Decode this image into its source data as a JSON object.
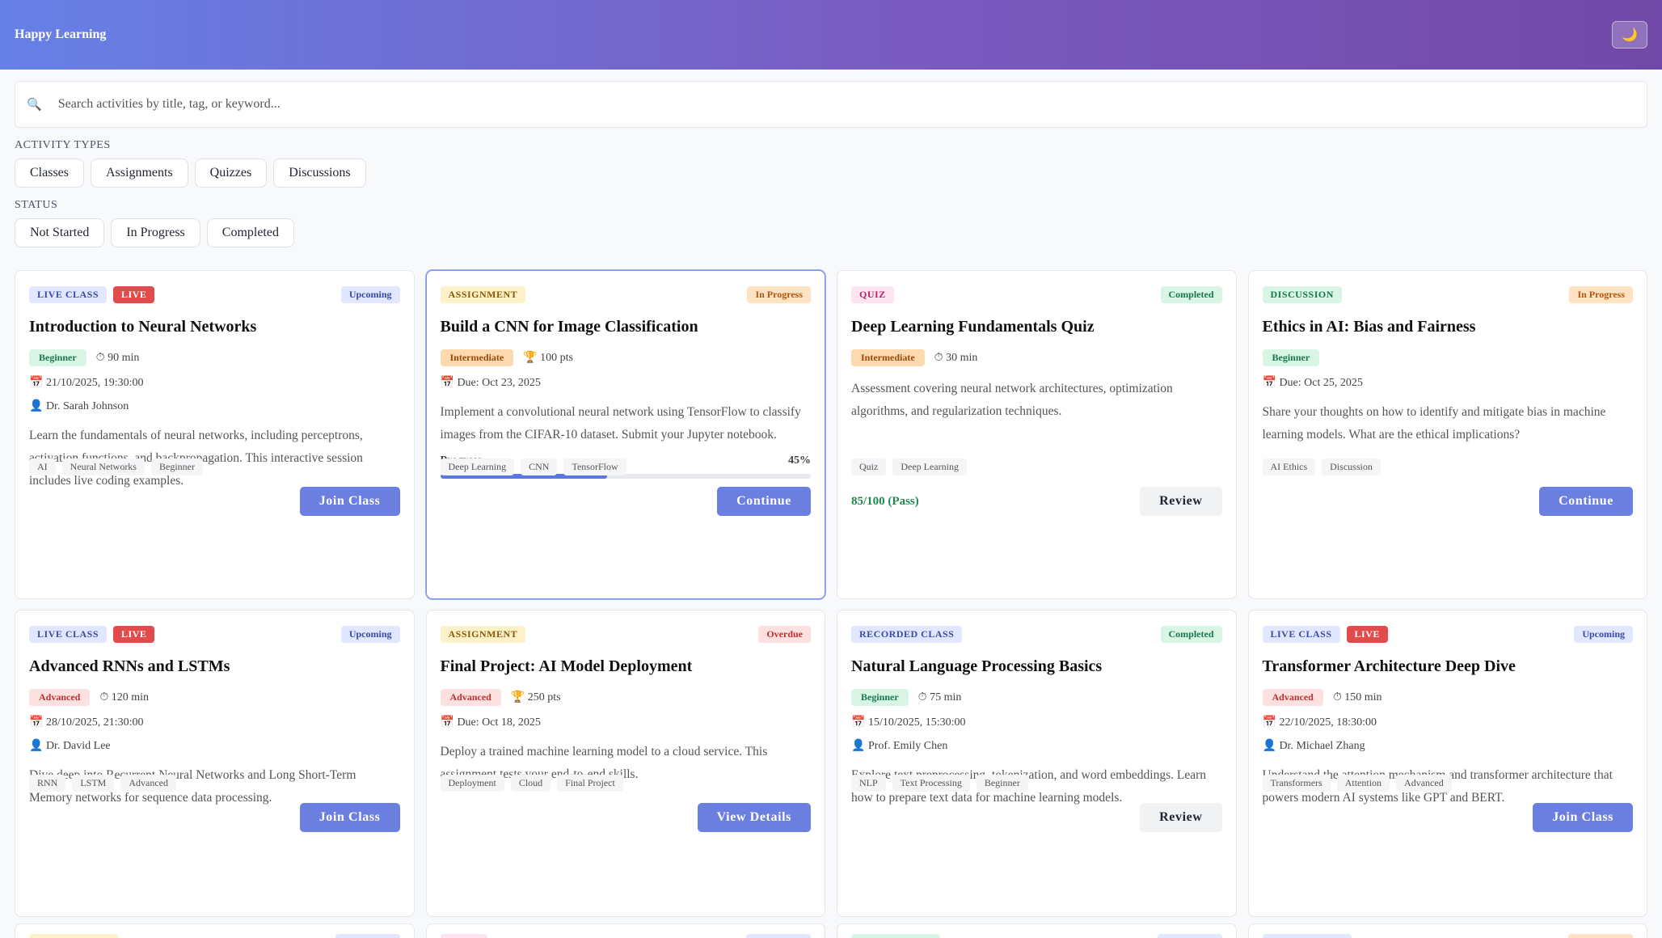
{
  "header": {
    "brand": "Happy Learning",
    "theme_toggle_icon": "moon-icon",
    "theme_toggle_glyph": "🌙"
  },
  "search": {
    "placeholder": "Search activities by title, tag, or keyword...",
    "value": "",
    "icon": "🔍"
  },
  "filters": {
    "types_label": "ACTIVITY TYPES",
    "types": [
      "Classes",
      "Assignments",
      "Quizzes",
      "Discussions"
    ],
    "status_label": "STATUS",
    "statuses": [
      "Not Started",
      "In Progress",
      "Completed"
    ]
  },
  "icons": {
    "clock": "⏱",
    "trophy": "🏆",
    "calendar": "📅",
    "person": "👤"
  },
  "cards": [
    {
      "type_label": "LIVE CLASS",
      "type_class": "b-live-class",
      "live": "LIVE",
      "status": "Upcoming",
      "status_class": "s-upcoming",
      "title": "Introduction to Neural Networks",
      "level": "Beginner",
      "level_class": "l-beginner",
      "meta_icon": "clock",
      "meta_text": "90 min",
      "date": "21/10/2025, 19:30:00",
      "instructor": "Dr. Sarah Johnson",
      "description": "Learn the fundamentals of neural networks, including perceptrons, activation functions, and backpropagation. This interactive session includes live coding examples.",
      "tags": [
        "AI",
        "Neural Networks",
        "Beginner"
      ],
      "button": "Join Class",
      "button_style": "primary"
    },
    {
      "type_label": "ASSIGNMENT",
      "type_class": "b-assignment",
      "status": "In Progress",
      "status_class": "s-inprogress",
      "title": "Build a CNN for Image Classification",
      "level": "Intermediate",
      "level_class": "l-intermediate",
      "meta_icon": "trophy",
      "meta_text": "100 pts",
      "date": "Due: Oct 23, 2025",
      "description": "Implement a convolutional neural network using TensorFlow to classify images from the CIFAR-10 dataset. Submit your Jupyter notebook.",
      "progress": {
        "label": "Progress",
        "value": 45,
        "text": "45%"
      },
      "tags": [
        "Deep Learning",
        "CNN",
        "TensorFlow"
      ],
      "button": "Continue",
      "button_style": "primary",
      "highlight": true
    },
    {
      "type_label": "QUIZ",
      "type_class": "b-quiz",
      "status": "Completed",
      "status_class": "s-completed",
      "title": "Deep Learning Fundamentals Quiz",
      "level": "Intermediate",
      "level_class": "l-intermediate",
      "meta_icon": "clock",
      "meta_text": "30 min",
      "description": "Assessment covering neural network architectures, optimization algorithms, and regularization techniques.",
      "tags": [
        "Quiz",
        "Deep Learning"
      ],
      "score": "85/100 (Pass)",
      "button": "Review",
      "button_style": "ghost"
    },
    {
      "type_label": "DISCUSSION",
      "type_class": "b-discussion",
      "status": "In Progress",
      "status_class": "s-inprogress",
      "title": "Ethics in AI: Bias and Fairness",
      "level": "Beginner",
      "level_class": "l-beginner",
      "date": "Due: Oct 25, 2025",
      "description": "Share your thoughts on how to identify and mitigate bias in machine learning models. What are the ethical implications?",
      "tags": [
        "AI Ethics",
        "Discussion"
      ],
      "button": "Continue",
      "button_style": "primary"
    },
    {
      "type_label": "LIVE CLASS",
      "type_class": "b-live-class",
      "live": "LIVE",
      "status": "Upcoming",
      "status_class": "s-upcoming",
      "title": "Advanced RNNs and LSTMs",
      "level": "Advanced",
      "level_class": "l-advanced",
      "meta_icon": "clock",
      "meta_text": "120 min",
      "date": "28/10/2025, 21:30:00",
      "instructor": "Dr. David Lee",
      "description": "Dive deep into Recurrent Neural Networks and Long Short-Term Memory networks for sequence data processing.",
      "tags": [
        "RNN",
        "LSTM",
        "Advanced"
      ],
      "button": "Join Class",
      "button_style": "primary"
    },
    {
      "type_label": "ASSIGNMENT",
      "type_class": "b-assignment",
      "status": "Overdue",
      "status_class": "s-overdue",
      "title": "Final Project: AI Model Deployment",
      "level": "Advanced",
      "level_class": "l-advanced",
      "meta_icon": "trophy",
      "meta_text": "250 pts",
      "date": "Due: Oct 18, 2025",
      "description": "Deploy a trained machine learning model to a cloud service. This assignment tests your end-to-end skills.",
      "tags": [
        "Deployment",
        "Cloud",
        "Final Project"
      ],
      "button": "View Details",
      "button_style": "primary"
    },
    {
      "type_label": "RECORDED CLASS",
      "type_class": "b-recorded",
      "status": "Completed",
      "status_class": "s-completed",
      "title": "Natural Language Processing Basics",
      "level": "Beginner",
      "level_class": "l-beginner",
      "meta_icon": "clock",
      "meta_text": "75 min",
      "date": "15/10/2025, 15:30:00",
      "instructor": "Prof. Emily Chen",
      "description": "Explore text preprocessing, tokenization, and word embeddings. Learn how to prepare text data for machine learning models.",
      "tags": [
        "NLP",
        "Text Processing",
        "Beginner"
      ],
      "button": "Review",
      "button_style": "ghost"
    },
    {
      "type_label": "LIVE CLASS",
      "type_class": "b-live-class",
      "live": "LIVE",
      "status": "Upcoming",
      "status_class": "s-upcoming",
      "title": "Transformer Architecture Deep Dive",
      "level": "Advanced",
      "level_class": "l-advanced",
      "meta_icon": "clock",
      "meta_text": "150 min",
      "date": "22/10/2025, 18:30:00",
      "instructor": "Dr. Michael Zhang",
      "description": "Understand the attention mechanism and transformer architecture that powers modern AI systems like GPT and BERT.",
      "tags": [
        "Transformers",
        "Attention",
        "Advanced"
      ],
      "button": "Join Class",
      "button_style": "primary"
    }
  ],
  "colors": {
    "accent": "#6b7fe0",
    "header_gradient_start": "#6680e6",
    "header_gradient_end": "#7149a8",
    "peek_badges": [
      "#fdf1c9",
      "#fde4f0",
      "#d8f5e6",
      "#e0e7ff"
    ],
    "peek_status": [
      "#e0e7ff",
      "#e0e7ff",
      "#e0e7ff",
      "#fde2c4"
    ]
  }
}
